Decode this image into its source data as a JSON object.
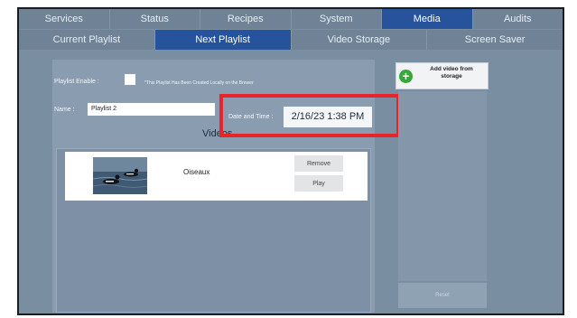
{
  "top_tabs": [
    {
      "label": "Services",
      "active": false
    },
    {
      "label": "Status",
      "active": false
    },
    {
      "label": "Recipes",
      "active": false
    },
    {
      "label": "System",
      "active": false
    },
    {
      "label": "Media",
      "active": true
    },
    {
      "label": "Audits",
      "active": false
    }
  ],
  "sub_tabs": [
    {
      "label": "Current Playlist",
      "active": false
    },
    {
      "label": "Next Playlist",
      "active": true
    },
    {
      "label": "Video Storage",
      "active": false
    },
    {
      "label": "Screen Saver",
      "active": false
    }
  ],
  "playlist": {
    "enable_label": "Playlist Enable :",
    "enable_checked": false,
    "enable_note": "*This Playlist Has Been Created Locally on the Brewer",
    "name_label": "Name :",
    "name_value": "Playlist 2",
    "datetime_label": "Date and Time :",
    "datetime_value": "2/16/23 1:38 PM"
  },
  "videos": {
    "title": "Videos",
    "items": [
      {
        "name": "Oiseaux",
        "remove_label": "Remove",
        "play_label": "Play"
      }
    ]
  },
  "sidebar": {
    "add_video_label": "Add video from storage",
    "reset_label": "Reset"
  },
  "colors": {
    "active_tab": "#26539b",
    "highlight": "#e8232a",
    "add_icon": "#35a83a"
  }
}
